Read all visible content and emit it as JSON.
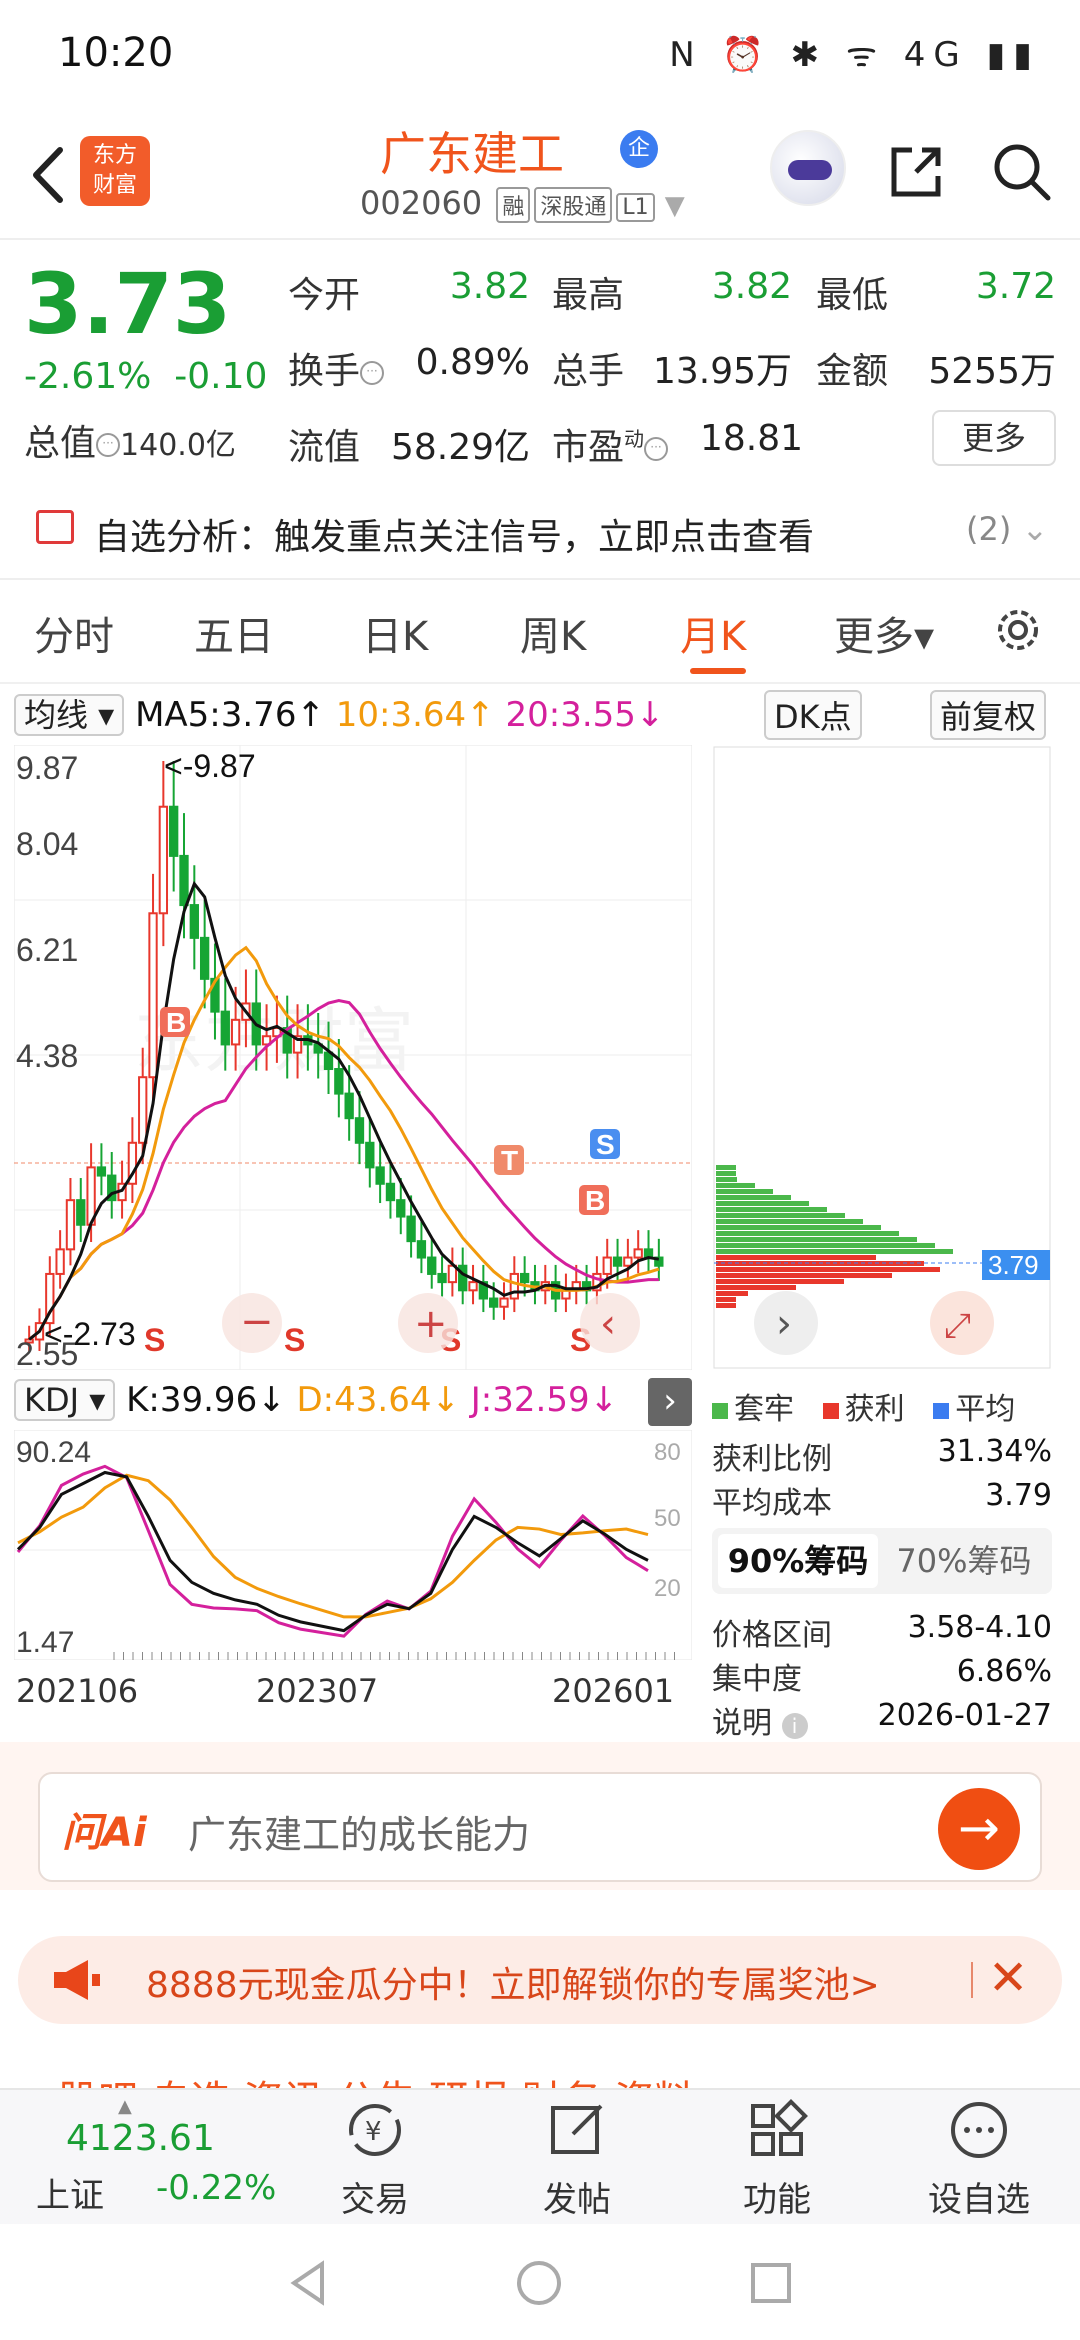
{
  "status": {
    "time": "10:20",
    "icons": "N ⏰ ✱ ᯤ 4G ▮▮"
  },
  "header": {
    "logo_top": "东方",
    "logo_bottom": "财富",
    "title": "广东建工",
    "title_badge": "企",
    "code": "002060",
    "tags": [
      "融",
      "深股通",
      "L1"
    ]
  },
  "quote": {
    "price": "3.73",
    "change_pct": "-2.61%",
    "change": "-0.10",
    "total_label": "总值",
    "total_value": "140.0亿",
    "open_label": "今开",
    "open_value": "3.82",
    "high_label": "最高",
    "high_value": "3.82",
    "low_label": "最低",
    "low_value": "3.72",
    "turnover_label": "换手",
    "turnover_value": "0.89%",
    "volume_label": "总手",
    "volume_value": "13.95万",
    "amount_label": "金额",
    "amount_value": "5255万",
    "float_label": "流值",
    "float_value": "58.29亿",
    "pe_label": "市盈",
    "pe_sup": "动",
    "pe_value": "18.81",
    "more_label": "更多"
  },
  "alert": {
    "text": "自选分析：触发重点关注信号，立即点击查看",
    "count": "(2)"
  },
  "tabs": [
    {
      "label": "分时"
    },
    {
      "label": "五日"
    },
    {
      "label": "日K"
    },
    {
      "label": "周K"
    },
    {
      "label": "月K"
    },
    {
      "label": "更多▾"
    }
  ],
  "indicators": {
    "ma_select": "均线 ▾",
    "ma5": "MA5:3.76↑",
    "ma10": "10:3.64↑",
    "ma20": "20:3.55↓",
    "dk_label": "DK点",
    "adjust_label": "前复权",
    "kdj_select": "KDJ ▾",
    "k": "K:39.96↓",
    "d": "D:43.64↓",
    "j": "J:32.59↓"
  },
  "chart_data": {
    "type": "candlestick",
    "y_ticks": [
      "9.87",
      "8.04",
      "6.21",
      "4.38",
      "2.55"
    ],
    "max_label": "<-9.87",
    "min_label": "<-2.73",
    "x_labels": [
      "202106",
      "202307",
      "202601"
    ],
    "kdj_ticks": [
      "90.24",
      "1.47"
    ],
    "kdj_right_ticks": [
      "80",
      "50",
      "20"
    ],
    "current_price_marker": "3.79",
    "signals": [
      "B",
      "S",
      "T",
      "B",
      "S",
      "S",
      "S",
      "S"
    ],
    "colors": {
      "up": "#e8372c",
      "down": "#16a534",
      "ma5": "#111111",
      "ma10": "#f29a0c",
      "ma20": "#d4209c"
    }
  },
  "chips": {
    "legend": [
      "套牢",
      "获利",
      "平均"
    ],
    "profit_ratio_label": "获利比例",
    "profit_ratio_value": "31.34%",
    "avg_cost_label": "平均成本",
    "avg_cost_value": "3.79",
    "tab_90": "90%筹码",
    "tab_70": "70%筹码",
    "range_label": "价格区间",
    "range_value": "3.58-4.10",
    "concentration_label": "集中度",
    "concentration_value": "6.86%",
    "note_label": "说明",
    "note_value": "2026-01-27"
  },
  "ai": {
    "logo": "问Ai",
    "prompt": "广东建工的成长能力",
    "go": "→"
  },
  "promo": {
    "text": "8888元现金瓜分中！立即解锁你的专属奖池>",
    "close": "✕"
  },
  "peek_tabs": "股吧   自选   资讯   公告   研报   财务   资料",
  "bottom_nav": {
    "index_value": "4123.61",
    "index_name": "上证",
    "index_change": "-0.22%",
    "items": [
      {
        "label": "交易"
      },
      {
        "label": "发帖"
      },
      {
        "label": "功能"
      },
      {
        "label": "设自选"
      }
    ]
  },
  "watermark": "东方财富"
}
